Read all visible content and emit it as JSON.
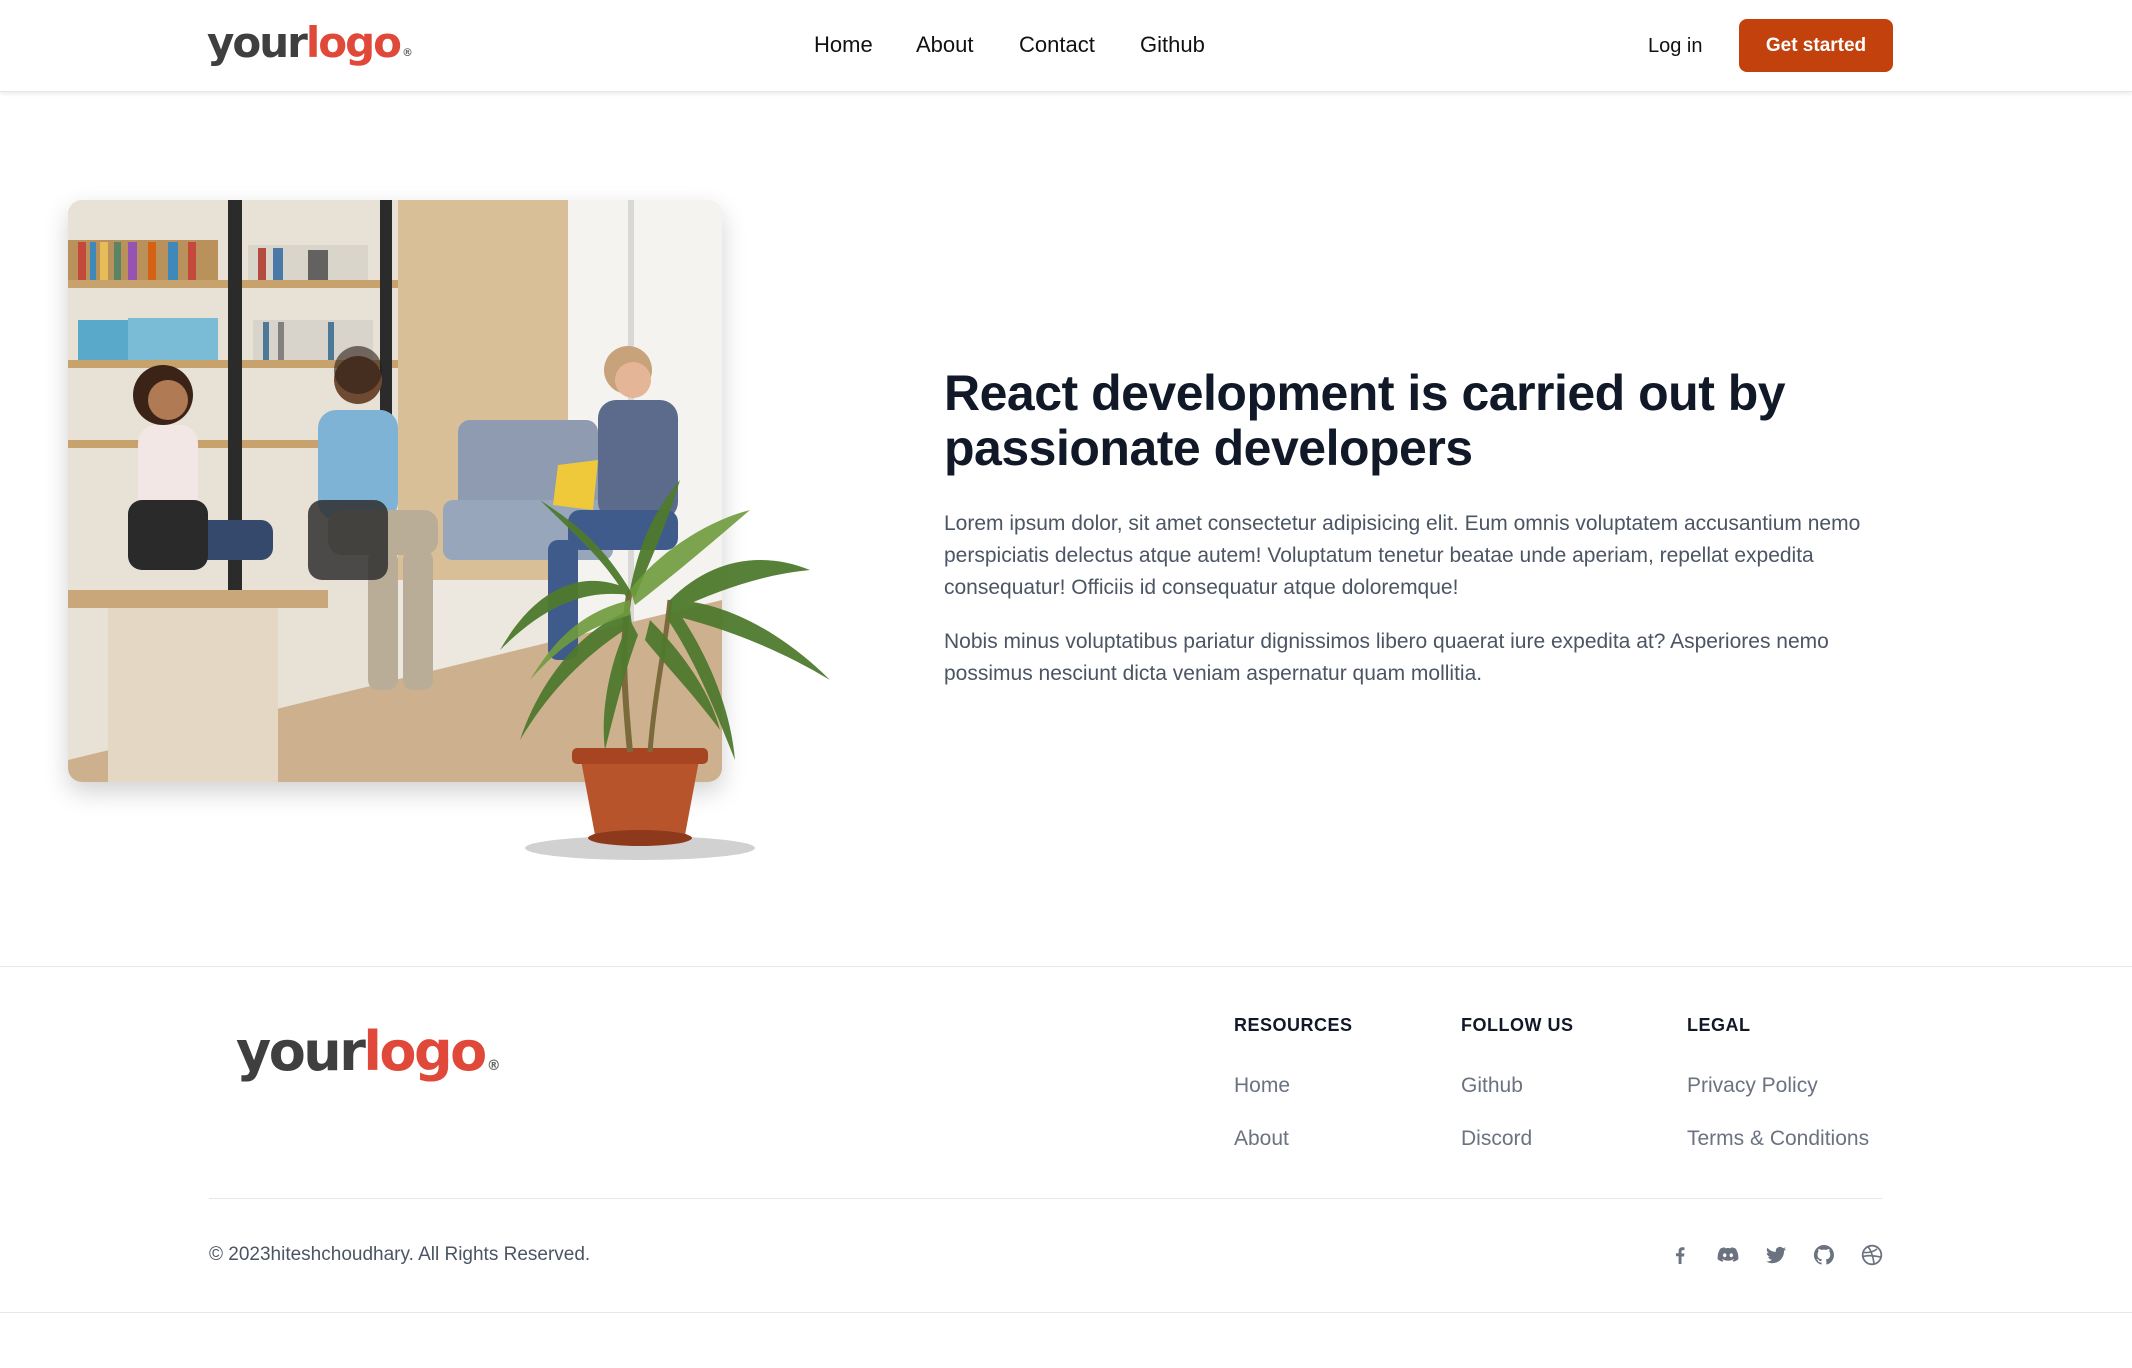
{
  "header": {
    "logo": {
      "word1": "your",
      "word2": "logo",
      "mark": "®"
    },
    "nav": [
      "Home",
      "About",
      "Contact",
      "Github"
    ],
    "login_label": "Log in",
    "cta_label": "Get started"
  },
  "hero": {
    "image_icon": "office-meeting-photo",
    "title": "React development is carried out by passionate developers",
    "paragraphs": [
      "Lorem ipsum dolor, sit amet consectetur adipisicing elit. Eum omnis voluptatem accusantium nemo perspiciatis delectus atque autem! Voluptatum tenetur beatae unde aperiam, repellat expedita consequatur! Officiis id consequatur atque doloremque!",
      "Nobis minus voluptatibus pariatur dignissimos libero quaerat iure expedita at? Asperiores nemo possimus nesciunt dicta veniam aspernatur quam mollitia."
    ]
  },
  "footer": {
    "logo": {
      "word1": "your",
      "word2": "logo",
      "mark": "®"
    },
    "columns": [
      {
        "heading": "RESOURCES",
        "links": [
          "Home",
          "About"
        ]
      },
      {
        "heading": "FOLLOW US",
        "links": [
          "Github",
          "Discord"
        ]
      },
      {
        "heading": "LEGAL",
        "links": [
          "Privacy Policy",
          "Terms & Conditions"
        ]
      }
    ],
    "copyright": "© 2023hiteshchoudhary. All Rights Reserved.",
    "social_icons": [
      "facebook-icon",
      "discord-icon",
      "twitter-icon",
      "github-icon",
      "dribbble-icon"
    ]
  },
  "colors": {
    "accent": "#c2410c",
    "logo_accent": "#e0493a",
    "heading": "#111827",
    "body_text": "#4b5563",
    "muted": "#6b7280"
  }
}
